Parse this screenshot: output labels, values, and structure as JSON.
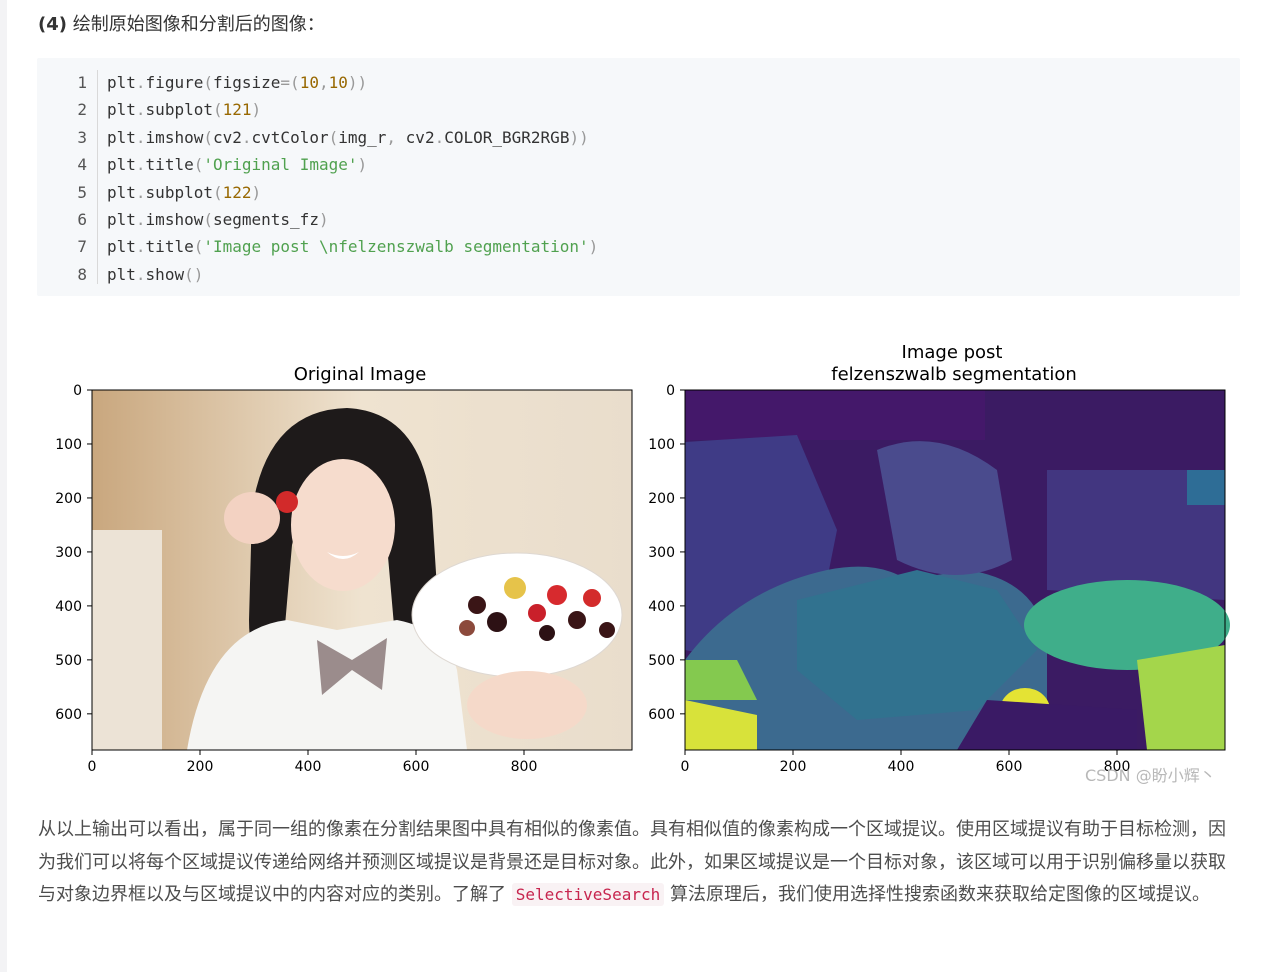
{
  "heading": {
    "num": "(4)",
    "text": " 绘制原始图像和分割后的图像："
  },
  "code_lines": [
    {
      "n": "1",
      "tokens": [
        [
          "plt",
          "t-obj"
        ],
        [
          ".",
          "t-dot"
        ],
        [
          "figure",
          "t-kw"
        ],
        [
          "(",
          "t-paren"
        ],
        [
          "figsize",
          "t-kw"
        ],
        [
          "=(",
          "t-paren"
        ],
        [
          "10",
          "t-num"
        ],
        [
          ",",
          "t-paren"
        ],
        [
          "10",
          "t-num"
        ],
        [
          "))",
          "t-paren"
        ]
      ]
    },
    {
      "n": "2",
      "tokens": [
        [
          "plt",
          "t-obj"
        ],
        [
          ".",
          "t-dot"
        ],
        [
          "subplot",
          "t-kw"
        ],
        [
          "(",
          "t-paren"
        ],
        [
          "121",
          "t-num"
        ],
        [
          ")",
          "t-paren"
        ]
      ]
    },
    {
      "n": "3",
      "tokens": [
        [
          "plt",
          "t-obj"
        ],
        [
          ".",
          "t-dot"
        ],
        [
          "imshow",
          "t-kw"
        ],
        [
          "(",
          "t-paren"
        ],
        [
          "cv2",
          "t-obj"
        ],
        [
          ".",
          "t-dot"
        ],
        [
          "cvtColor",
          "t-kw"
        ],
        [
          "(",
          "t-paren"
        ],
        [
          "img_r",
          "t-obj"
        ],
        [
          ", ",
          "t-paren"
        ],
        [
          "cv2",
          "t-obj"
        ],
        [
          ".",
          "t-dot"
        ],
        [
          "COLOR_BGR2RGB",
          "t-kw"
        ],
        [
          "))",
          "t-paren"
        ]
      ]
    },
    {
      "n": "4",
      "tokens": [
        [
          "plt",
          "t-obj"
        ],
        [
          ".",
          "t-dot"
        ],
        [
          "title",
          "t-kw"
        ],
        [
          "(",
          "t-paren"
        ],
        [
          "'Original Image'",
          "t-str"
        ],
        [
          ")",
          "t-paren"
        ]
      ]
    },
    {
      "n": "5",
      "tokens": [
        [
          "plt",
          "t-obj"
        ],
        [
          ".",
          "t-dot"
        ],
        [
          "subplot",
          "t-kw"
        ],
        [
          "(",
          "t-paren"
        ],
        [
          "122",
          "t-num"
        ],
        [
          ")",
          "t-paren"
        ]
      ]
    },
    {
      "n": "6",
      "tokens": [
        [
          "plt",
          "t-obj"
        ],
        [
          ".",
          "t-dot"
        ],
        [
          "imshow",
          "t-kw"
        ],
        [
          "(",
          "t-paren"
        ],
        [
          "segments_fz",
          "t-obj"
        ],
        [
          ")",
          "t-paren"
        ]
      ]
    },
    {
      "n": "7",
      "tokens": [
        [
          "plt",
          "t-obj"
        ],
        [
          ".",
          "t-dot"
        ],
        [
          "title",
          "t-kw"
        ],
        [
          "(",
          "t-paren"
        ],
        [
          "'Image post \\nfelzenszwalb segmentation'",
          "t-str"
        ],
        [
          ")",
          "t-paren"
        ]
      ]
    },
    {
      "n": "8",
      "tokens": [
        [
          "plt",
          "t-obj"
        ],
        [
          ".",
          "t-dot"
        ],
        [
          "show",
          "t-kw"
        ],
        [
          "()",
          "t-paren"
        ]
      ]
    }
  ],
  "figure": {
    "left_title": "Original Image",
    "right_title_1": "Image post",
    "right_title_2": "felzenszwalb segmentation",
    "xticks": [
      "0",
      "200",
      "400",
      "600",
      "800"
    ],
    "yticks": [
      "0",
      "100",
      "200",
      "300",
      "400",
      "500",
      "600"
    ],
    "watermark": "CSDN @盼小辉丶"
  },
  "paragraph": {
    "part1": "从以上输出可以看出，属于同一组的像素在分割结果图中具有相似的像素值。具有相似值的像素构成一个区域提议。使用区域提议有助于目标检测，因为我们可以将每个区域提议传递给网络并预测区域提议是背景还是目标对象。此外，如果区域提议是一个目标对象，该区域可以用于识别偏移量以获取与对象边界框以及与区域提议中的内容对应的类别。了解了 ",
    "code": "SelectiveSearch",
    "part2": " 算法原理后，我们使用选择性搜索函数来获取给定图像的区域提议。"
  }
}
